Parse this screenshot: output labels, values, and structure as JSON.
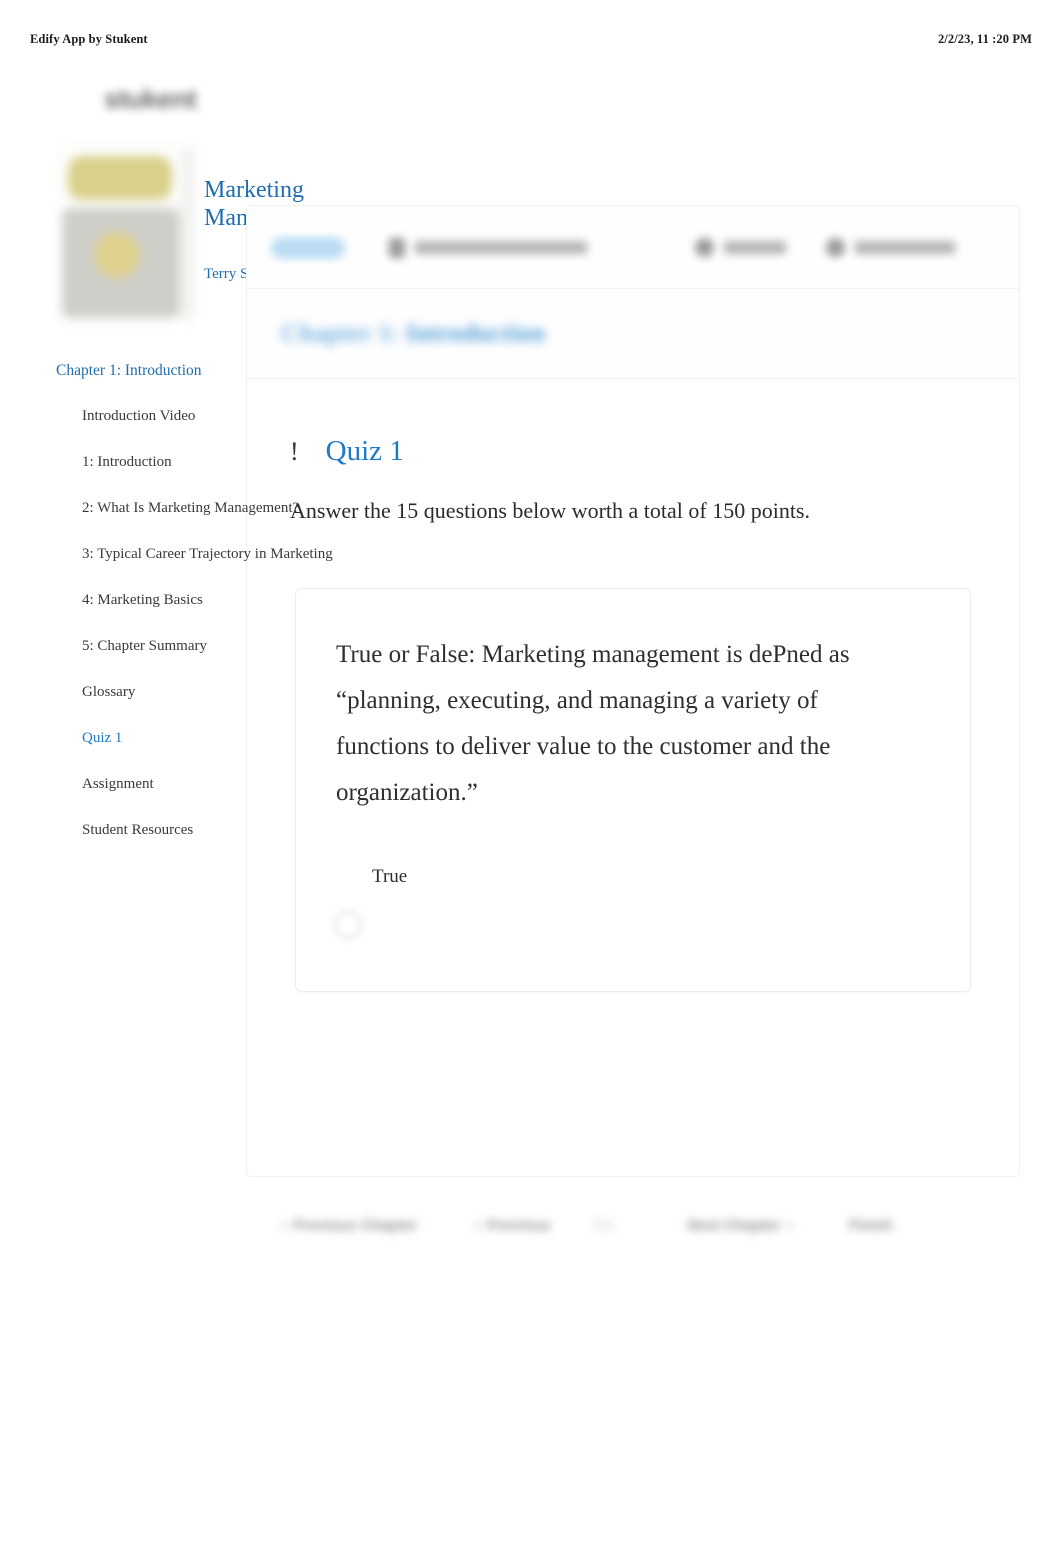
{
  "print_header": {
    "app_name": "Edify App by Stukent",
    "timestamp": "2/2/23, 11 :20 PM"
  },
  "brand": {
    "logo_text": "stukent"
  },
  "book": {
    "title_line1": "Marketing",
    "title_line2": "Management Today",
    "author": "Terry Sullivan",
    "cover_alt": "book-cover-thumbnail"
  },
  "top_nav": {
    "search_pill": "Search",
    "items": [
      {
        "icon": "lock-icon",
        "label": "Select a section",
        "label_width": 172
      },
      {
        "icon": "gradebook-icon",
        "label": "Grades",
        "label_width": 62
      },
      {
        "icon": "user-icon",
        "label": "Dashboard",
        "label_width": 100
      }
    ]
  },
  "chapter_bar": {
    "prefix": "Chapter 1:",
    "name": "Introduction"
  },
  "sidebar": {
    "heading": "Chapter 1: Introduction",
    "items": [
      {
        "label": "Introduction Video",
        "active": false
      },
      {
        "label": "1: Introduction",
        "active": false
      },
      {
        "label": "2: What Is Marketing Management?",
        "active": false
      },
      {
        "label": "3: Typical Career Trajectory in Marketing",
        "active": false
      },
      {
        "label": "4: Marketing Basics",
        "active": false
      },
      {
        "label": "5: Chapter Summary",
        "active": false
      },
      {
        "label": "Glossary",
        "active": false
      },
      {
        "label": "Quiz 1",
        "active": true
      },
      {
        "label": "Assignment",
        "active": false
      },
      {
        "label": "Student Resources",
        "active": false
      }
    ]
  },
  "quiz": {
    "alert_glyph": "!",
    "title": "Quiz 1",
    "instructions": "Answer the 15 questions below worth a total of 150 points.",
    "question": {
      "text": "True or False: Marketing management is dePned as “planning, executing, and managing a variety of functions to deliver value to the customer and the organization.”",
      "options": [
        {
          "label": "True",
          "selected": false
        }
      ]
    }
  },
  "bottom_nav": {
    "previous_chapter": "Previous Chapter",
    "previous": "Previous",
    "page_indicator": "1/1",
    "next_chapter": "Next Chapter",
    "finish": "Finish",
    "chevron_left": "‹",
    "chevron_right": "›"
  },
  "colors": {
    "link_blue": "#1f6cb0",
    "accent_blue": "#1f7ac4",
    "chapter_blue": "#4a9ad4",
    "text": "#2b2b2b",
    "panel_border": "#f0f1f2"
  }
}
